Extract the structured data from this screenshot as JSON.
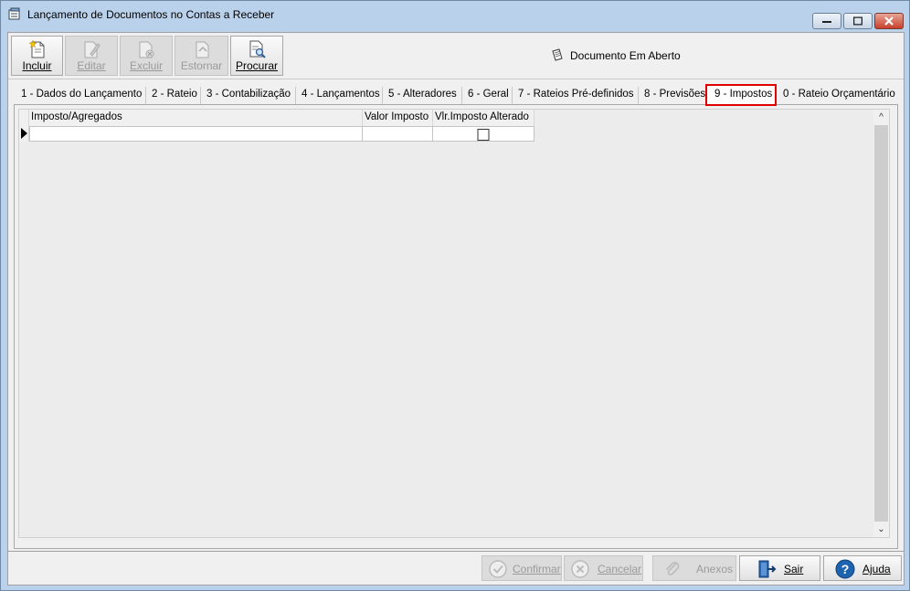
{
  "window": {
    "title": "Lançamento de Documentos no Contas a Receber"
  },
  "toolbar": {
    "buttons": [
      {
        "label": "Incluir",
        "icon": "new-document-icon",
        "enabled": true
      },
      {
        "label": "Editar",
        "icon": "edit-document-icon",
        "enabled": false
      },
      {
        "label": "Excluir",
        "icon": "delete-document-icon",
        "enabled": false
      },
      {
        "label": "Estornar",
        "icon": "reverse-document-icon",
        "enabled": false
      },
      {
        "label": "Procurar",
        "icon": "search-document-icon",
        "enabled": true
      }
    ],
    "status": "Documento Em Aberto"
  },
  "tabs": [
    {
      "label": "1 - Dados do Lançamento"
    },
    {
      "label": "2 - Rateio"
    },
    {
      "label": "3 - Contabilização"
    },
    {
      "label": "4 - Lançamentos"
    },
    {
      "label": "5 - Alteradores"
    },
    {
      "label": "6 - Geral"
    },
    {
      "label": "7 - Rateios Pré-definidos"
    },
    {
      "label": "8 - Previsões"
    },
    {
      "label": "9 - Impostos",
      "active": true
    },
    {
      "label": "0 - Rateio Orçamentário"
    }
  ],
  "grid": {
    "columns": [
      "Imposto/Agregados",
      "Valor Imposto",
      "Vlr.Imposto Alterado"
    ],
    "rows": [
      {
        "imposto": "",
        "valor": "",
        "alterado": false
      }
    ]
  },
  "footer": {
    "buttons": [
      {
        "label": "Confirmar",
        "icon": "check-circle-icon",
        "enabled": false
      },
      {
        "label": "Cancelar",
        "icon": "x-circle-icon",
        "enabled": false
      },
      {
        "label": "Anexos",
        "icon": "paperclip-icon",
        "enabled": false
      },
      {
        "label": "Sair",
        "icon": "exit-door-icon",
        "enabled": true
      },
      {
        "label": "Ajuda",
        "icon": "help-icon",
        "enabled": true
      }
    ]
  },
  "colors": {
    "titlebar": "#b9d1ea",
    "active_tab_highlight": "#e00000",
    "help_blue": "#1e63b0"
  }
}
